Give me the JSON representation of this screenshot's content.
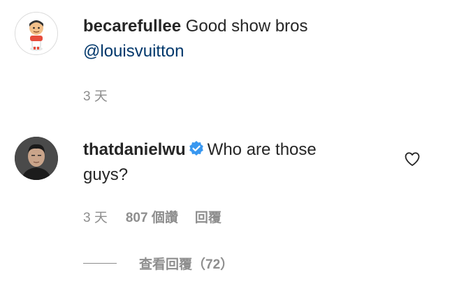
{
  "comments": [
    {
      "username": "becarefullee",
      "text": "Good show bros",
      "mention": "@louisvuitton",
      "time": "3 天"
    },
    {
      "username": "thatdanielwu",
      "verified": true,
      "text_line1": "Who are those",
      "text_line2": "guys?",
      "time": "3 天",
      "likes": "807 個讚",
      "reply_label": "回覆"
    }
  ],
  "view_replies": {
    "label": "查看回覆（72）"
  },
  "icons": {
    "verified": "verified-badge-icon",
    "like": "heart-icon"
  },
  "colors": {
    "text": "#262626",
    "secondary": "#8e8e8e",
    "mention": "#00376b",
    "verified": "#3897f0"
  }
}
